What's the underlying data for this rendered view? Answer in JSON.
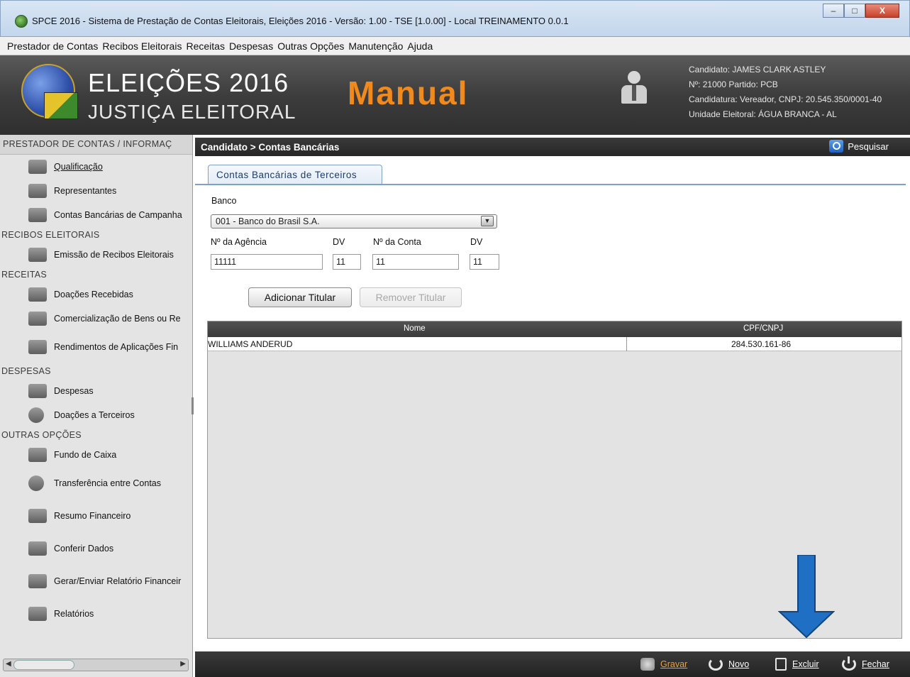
{
  "window": {
    "title": "SPCE 2016 - Sistema de Prestação de Contas Eleitorais, Eleições 2016 - Versão: 1.00  -  TSE [1.0.00] - Local TREINAMENTO 0.0.1",
    "btn_min": "–",
    "btn_max": "□",
    "btn_close": "X"
  },
  "menu": [
    "Prestador de Contas",
    "Recibos Eleitorais",
    "Receitas",
    "Despesas",
    "Outras Opções",
    "Manutenção",
    "Ajuda"
  ],
  "banner": {
    "brand_line1": "ELEIÇÕES 2016",
    "brand_line2": "JUSTIÇA ELEITORAL",
    "mode": "Manual",
    "candidate": "Candidato: JAMES CLARK ASTLEY",
    "number_party": "Nº: 21000 Partido: PCB",
    "candidacy": "Candidatura: Vereador, CNPJ: 20.545.350/0001-40",
    "unit": "Unidade Eleitoral: ÁGUA BRANCA - AL"
  },
  "sidebar": {
    "sec_prestador": "PRESTADOR DE CONTAS / INFORMAÇ",
    "qualificacao": "Qualificação",
    "representantes": "Representantes",
    "contas_bancarias": "Contas Bancárias de Campanha",
    "sec_recibos": "RECIBOS ELEITORAIS",
    "emissao_recibos": "Emissão de Recibos Eleitorais",
    "sec_receitas": "RECEITAS",
    "doacoes_recebidas": "Doações Recebidas",
    "comercializacao": "Comercialização de Bens ou Re",
    "rendimentos": "Rendimentos de Aplicações Fin",
    "sec_despesas": "DESPESAS",
    "despesas": "Despesas",
    "doacoes_terceiros": "Doações a Terceiros",
    "sec_outras": "OUTRAS OPÇÕES",
    "fundo_caixa": "Fundo de Caixa",
    "transferencia": "Transferência entre Contas",
    "resumo": "Resumo Financeiro",
    "conferir": "Conferir Dados",
    "gerar_enviar": "Gerar/Enviar Relatório Financeir",
    "relatorios": "Relatórios"
  },
  "content": {
    "breadcrumb": "Candidato > Contas Bancárias",
    "search_label": "Pesquisar",
    "tab_label": "Contas Bancárias de Terceiros",
    "banco_label": "Banco",
    "banco_value": "001 - Banco do Brasil S.A.",
    "agencia_label": "Nº da Agência",
    "agencia_value": "11111",
    "dv1_label": "DV",
    "dv1_value": "11",
    "conta_label": "Nº da Conta",
    "conta_value": "11",
    "dv2_label": "DV",
    "dv2_value": "11",
    "add_titular": "Adicionar Titular",
    "remove_titular": "Remover Titular",
    "table": {
      "col_nome": "Nome",
      "col_cpf": "CPF/CNPJ",
      "rows": [
        {
          "nome": "WILLIAMS ANDERUD",
          "cpf": "284.530.161-86"
        }
      ]
    }
  },
  "footer": {
    "gravar": "Gravar",
    "novo": "Novo",
    "excluir": "Excluir",
    "fechar": "Fechar"
  },
  "colors": {
    "accent": "#f08a1c",
    "arrow": "#1f6fc4",
    "header_dark": "#2f2f2f"
  }
}
